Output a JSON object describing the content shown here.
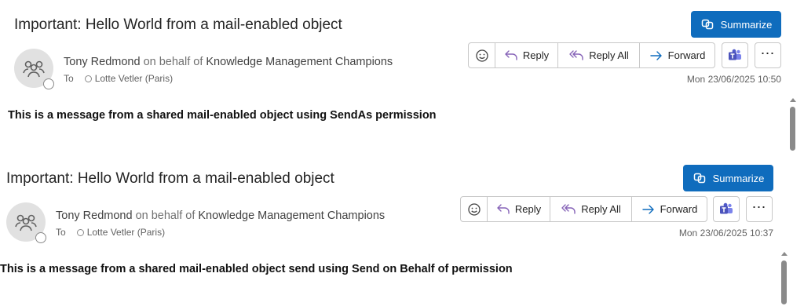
{
  "summarize_label": "Summarize",
  "actions": {
    "reply": "Reply",
    "reply_all": "Reply All",
    "forward": "Forward"
  },
  "icons": [
    "summarize-icon",
    "avatar-group-icon",
    "emoji-icon",
    "reply-icon",
    "reply-all-icon",
    "forward-icon",
    "teams-icon",
    "more-icon"
  ],
  "colors": {
    "accent": "#0f6cbd",
    "teams": "#4b53bc"
  },
  "messages": [
    {
      "subject": "Important: Hello World from a mail-enabled object",
      "sender_name": "Tony Redmond",
      "on_behalf_prefix": "on behalf of",
      "on_behalf_name": "Knowledge Management Champions",
      "to_label": "To",
      "recipient": "Lotte Vetler (Paris)",
      "date": "Mon 23/06/2025 10:50",
      "body": "This is a message from a shared mail-enabled object using SendAs permission"
    },
    {
      "subject": "Important: Hello World from a mail-enabled object",
      "sender_name": "Tony Redmond",
      "on_behalf_prefix": "on behalf of",
      "on_behalf_name": "Knowledge Management Champions",
      "to_label": "To",
      "recipient": "Lotte Vetler (Paris)",
      "date": "Mon 23/06/2025 10:37",
      "body": "This is a message from a shared mail-enabled object send using Send on Behalf of permission"
    }
  ]
}
